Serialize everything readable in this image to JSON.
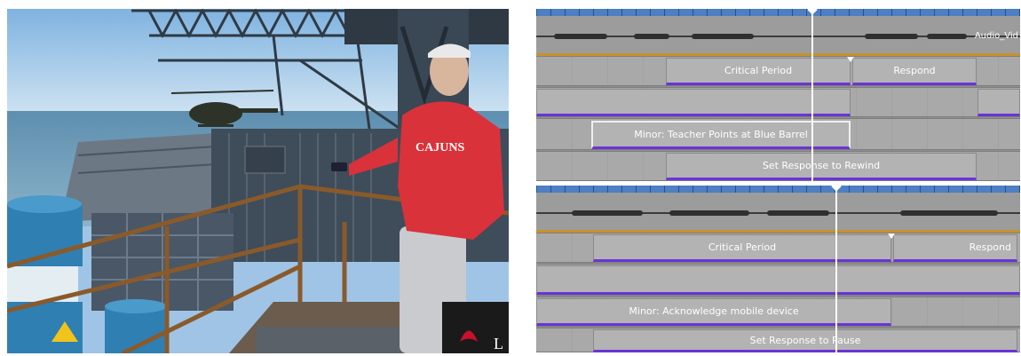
{
  "scene": {
    "logo_text": "L"
  },
  "timeline_top": {
    "audio_track_label": "Audio_Vid",
    "clips": {
      "critical_period": "Critical Period",
      "respond": "Respond",
      "minor_event": "Minor: Teacher Points at Blue Barrel",
      "set_response": "Set Response to Rewind"
    }
  },
  "timeline_bottom": {
    "clips": {
      "critical_period": "Critical Period",
      "respond": "Respond",
      "minor_event": "Minor: Acknowledge mobile device",
      "set_response": "Set Response to Pause"
    }
  },
  "colors": {
    "ruler": "#4d7fc2",
    "audio_underline": "#c7922c",
    "clip_underline": "#6a34d8",
    "playhead": "#ffffff"
  }
}
